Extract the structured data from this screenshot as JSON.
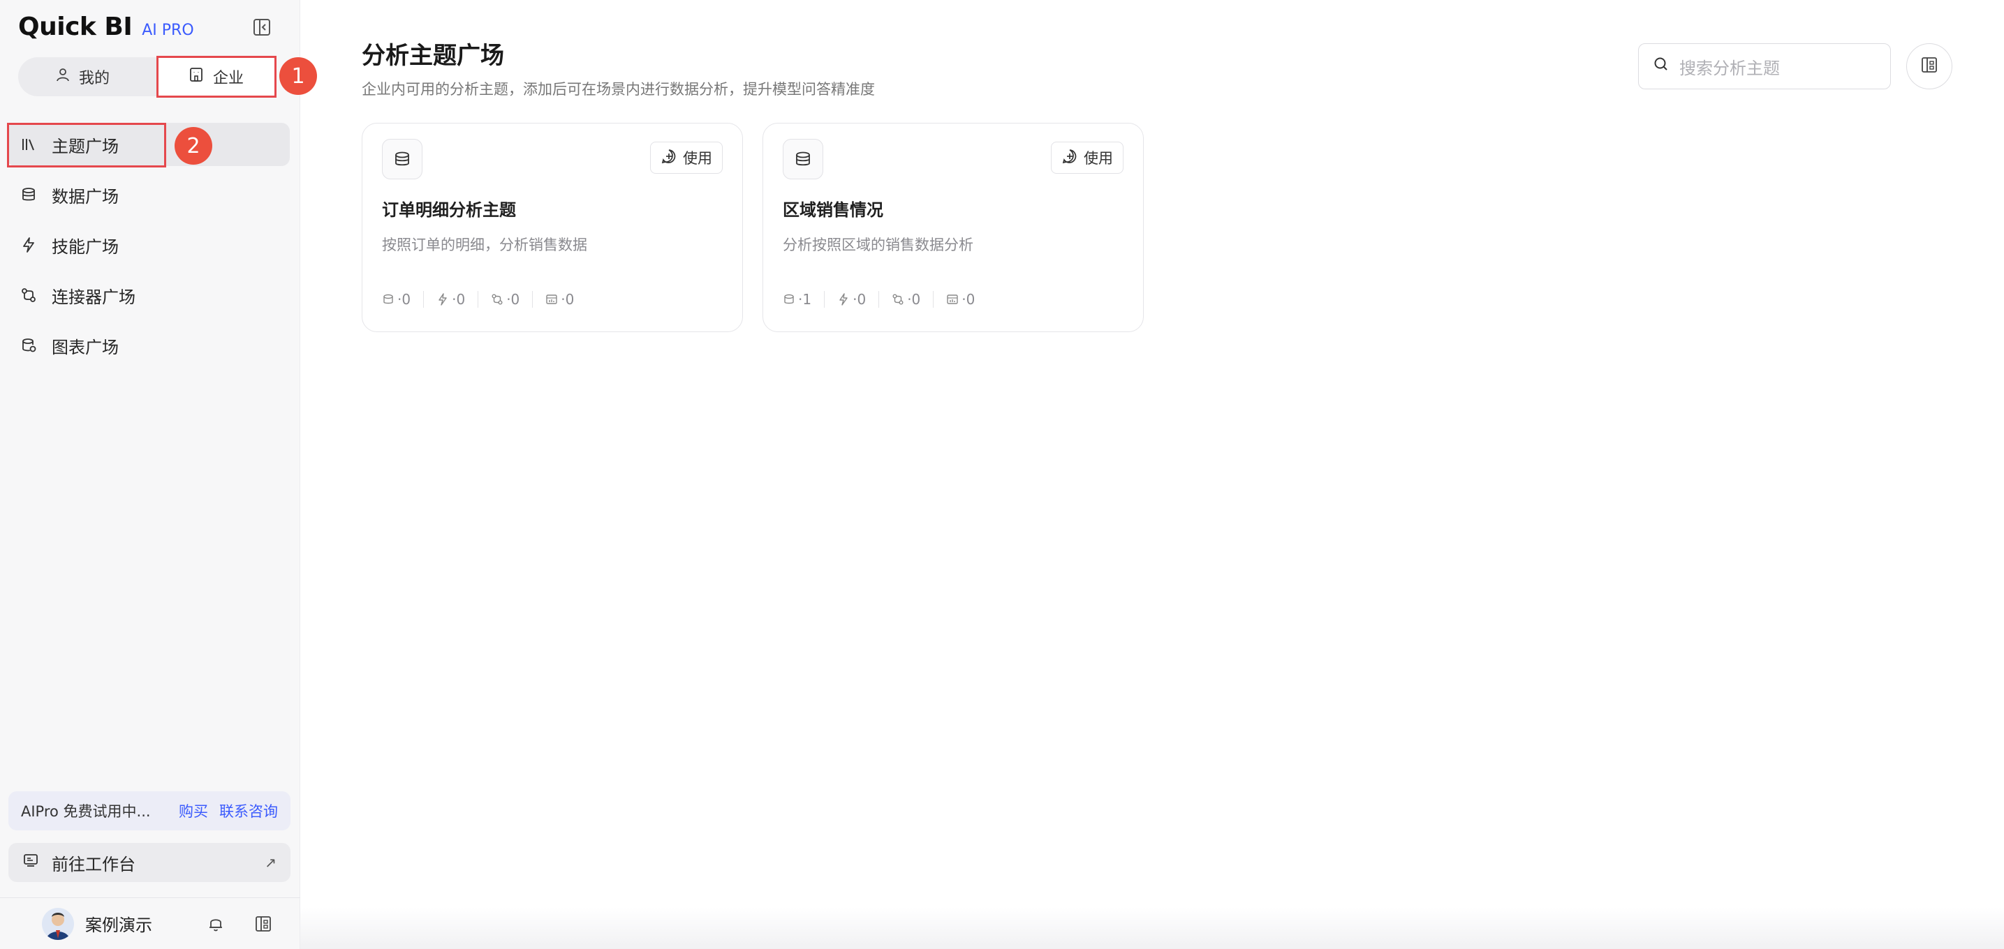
{
  "brand": {
    "name": "Quick BI",
    "badge": "AI PRO"
  },
  "scope_tabs": [
    {
      "label": "我的"
    },
    {
      "label": "企业"
    }
  ],
  "markers": [
    "1",
    "2"
  ],
  "nav": {
    "items": [
      {
        "label": "主题广场",
        "icon": "library-icon",
        "active": true
      },
      {
        "label": "数据广场",
        "icon": "database-icon"
      },
      {
        "label": "技能广场",
        "icon": "lightning-icon"
      },
      {
        "label": "连接器广场",
        "icon": "connector-icon"
      },
      {
        "label": "图表广场",
        "icon": "chart-db-icon"
      }
    ]
  },
  "trial": {
    "text": "AIPro 免费试用中...",
    "buy": "购买",
    "contact": "联系咨询"
  },
  "goto_workbench": {
    "label": "前往工作台",
    "arrow": "↗"
  },
  "user": {
    "name": "案例演示"
  },
  "main": {
    "title": "分析主题广场",
    "subtitle": "企业内可用的分析主题，添加后可在场景内进行数据分析，提升模型问答精准度",
    "search_placeholder": "搜索分析主题"
  },
  "cards": [
    {
      "title": "订单明细分析主题",
      "description": "按照订单的明细，分析销售数据",
      "use_label": "使用",
      "stats": {
        "data": "·0",
        "skills": "·0",
        "connectors": "·0",
        "charts": "·0"
      }
    },
    {
      "title": "区域销售情况",
      "description": "分析按照区域的销售数据分析",
      "use_label": "使用",
      "stats": {
        "data": "·1",
        "skills": "·0",
        "connectors": "·0",
        "charts": "·0"
      }
    }
  ],
  "colors": {
    "accent": "#3b5bfd",
    "annotation": "#e5484d"
  }
}
